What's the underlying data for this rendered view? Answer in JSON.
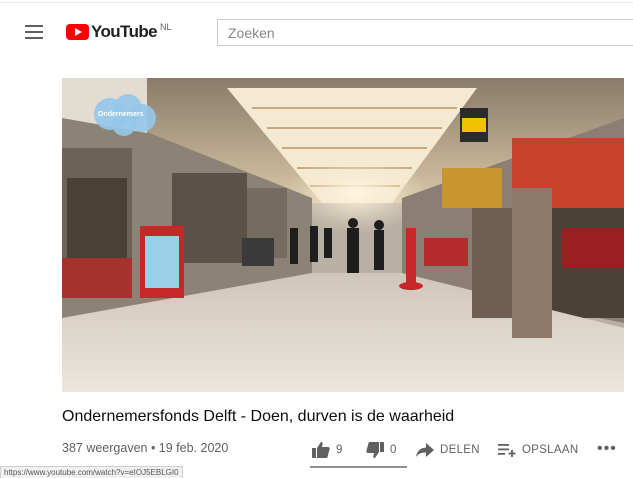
{
  "header": {
    "logo_text": "YouTube",
    "country_code": "NL",
    "search_placeholder": "Zoeken"
  },
  "video": {
    "overlay_text": "Ondernemers",
    "title": "Ondernemersfonds Delft - Doen, durven is de waarheid",
    "meta": "387 weergaven • 19 feb. 2020"
  },
  "actions": {
    "likes": "9",
    "dislikes": "0",
    "share_label": "DELEN",
    "save_label": "OPSLAAN",
    "more_label": "•••"
  },
  "status_bar": {
    "url": "https://www.youtube.com/watch?v=eIOJ5EBLGI0"
  },
  "colors": {
    "brand_red": "#ff0000",
    "text_primary": "#0d0d0d",
    "text_secondary": "#606060"
  }
}
